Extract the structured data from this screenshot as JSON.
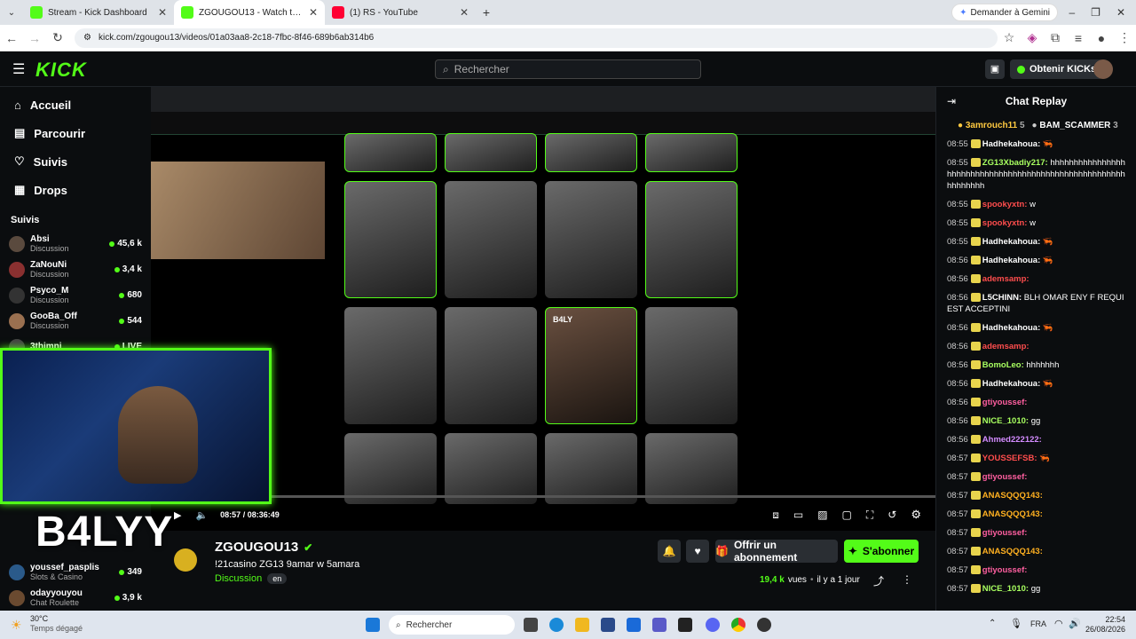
{
  "browser": {
    "tabs": [
      {
        "title": "Stream - Kick Dashboard",
        "color": "#53fc18"
      },
      {
        "title": "ZGOUGOU13 - Watch the VOD",
        "color": "#53fc18"
      },
      {
        "title": "(1) RS - YouTube",
        "color": "#ff0033"
      }
    ],
    "url": "kick.com/zgougou13/videos/01a03aa8-2c18-7fbc-8f46-689b6ab314b6",
    "gemini": "Demander à Gemini"
  },
  "header": {
    "logo": "KICK",
    "search_placeholder": "Rechercher",
    "kicks": "Obtenir KICKs"
  },
  "sidebar": {
    "nav": [
      {
        "label": "Accueil",
        "icon": "⌂"
      },
      {
        "label": "Parcourir",
        "icon": "▤"
      },
      {
        "label": "Suivis",
        "icon": "♡"
      },
      {
        "label": "Drops",
        "icon": "▦"
      }
    ],
    "follow_header": "Suivis",
    "follows": [
      {
        "name": "Absi",
        "cat": "Discussion",
        "count": "45,6 k"
      },
      {
        "name": "ZaNouNi",
        "cat": "Discussion",
        "count": "3,4 k"
      },
      {
        "name": "Psyco_M",
        "cat": "Discussion",
        "count": "680"
      },
      {
        "name": "GooBa_Off",
        "cat": "Discussion",
        "count": "544"
      },
      {
        "name": "3thimni",
        "cat": "",
        "count": "LIVE"
      }
    ],
    "follows_bottom": [
      {
        "name": "youssef_pasplis",
        "cat": "Slots & Casino",
        "count": "349"
      },
      {
        "name": "odayyouyou",
        "cat": "Chat Roulette",
        "count": "3,9 k"
      }
    ]
  },
  "player": {
    "time": "08:57 / 08:36:49",
    "overlay_text": "B4LYY",
    "card_label": "B4LY"
  },
  "channel": {
    "name": "ZGOUGOU13",
    "title": "!21casino ZG13 9amar w 5amara",
    "category": "Discussion",
    "lang": "en",
    "views_num": "19,4 k",
    "views_label": "vues",
    "ago": "il y a 1 jour",
    "sub_btn": "Offrir un abonnement",
    "follow_btn": "S'abonner"
  },
  "chat": {
    "title": "Chat Replay",
    "pinned": [
      {
        "name": "3amrouch11",
        "n": "5"
      },
      {
        "name": "BAM_SCAMMER",
        "n": "3"
      }
    ],
    "messages": [
      {
        "t": "08:55",
        "u": "Hadhekahoua:",
        "c": "#ffffff",
        "m": "🦐"
      },
      {
        "t": "08:55",
        "u": "ZG13Xbadiy217:",
        "c": "#a8ff60",
        "m": "hhhhhhhhhhhhhhhhhhhhhhhhhhhhhhhhhhhhhhhhhhhhhhhhhhhhhhhhhhhhhh"
      },
      {
        "t": "08:55",
        "u": "spookyxtn:",
        "c": "#ff4d4d",
        "m": "w"
      },
      {
        "t": "08:55",
        "u": "spookyxtn:",
        "c": "#ff4d4d",
        "m": "w"
      },
      {
        "t": "08:55",
        "u": "Hadhekahoua:",
        "c": "#ffffff",
        "m": "🦐"
      },
      {
        "t": "08:56",
        "u": "Hadhekahoua:",
        "c": "#ffffff",
        "m": "🦐"
      },
      {
        "t": "08:56",
        "u": "ademsamp:",
        "c": "#ff4d4d",
        "m": ""
      },
      {
        "t": "08:56",
        "u": "L5CHINN:",
        "c": "#ffffff",
        "m": "BLH OMAR ENY F REQUIEST ACCEPTINI"
      },
      {
        "t": "08:56",
        "u": "Hadhekahoua:",
        "c": "#ffffff",
        "m": "🦐"
      },
      {
        "t": "08:56",
        "u": "ademsamp:",
        "c": "#ff4d4d",
        "m": ""
      },
      {
        "t": "08:56",
        "u": "BomoLeo:",
        "c": "#a8ff60",
        "m": "hhhhhhh"
      },
      {
        "t": "08:56",
        "u": "Hadhekahoua:",
        "c": "#ffffff",
        "m": "🦐"
      },
      {
        "t": "08:56",
        "u": "gtiyoussef:",
        "c": "#ff5fa0",
        "m": ""
      },
      {
        "t": "08:56",
        "u": "NICE_1010:",
        "c": "#a8ff60",
        "m": "gg"
      },
      {
        "t": "08:56",
        "u": "Ahmed222122:",
        "c": "#d48cff",
        "m": ""
      },
      {
        "t": "08:57",
        "u": "YOUSSEFSB:",
        "c": "#ff4d4d",
        "m": "🦐"
      },
      {
        "t": "08:57",
        "u": "gtiyoussef:",
        "c": "#ff5fa0",
        "m": ""
      },
      {
        "t": "08:57",
        "u": "ANASQQQ143:",
        "c": "#ffb020",
        "m": ""
      },
      {
        "t": "08:57",
        "u": "ANASQQQ143:",
        "c": "#ffb020",
        "m": ""
      },
      {
        "t": "08:57",
        "u": "gtiyoussef:",
        "c": "#ff5fa0",
        "m": ""
      },
      {
        "t": "08:57",
        "u": "ANASQQQ143:",
        "c": "#ffb020",
        "m": ""
      },
      {
        "t": "08:57",
        "u": "gtiyoussef:",
        "c": "#ff5fa0",
        "m": ""
      },
      {
        "t": "08:57",
        "u": "NICE_1010:",
        "c": "#a8ff60",
        "m": "gg"
      }
    ]
  },
  "taskbar": {
    "weather_temp": "30°C",
    "weather_desc": "Temps dégagé",
    "search": "Rechercher",
    "lang": "FRA",
    "time": "22:54",
    "date": "26/08/2026"
  }
}
